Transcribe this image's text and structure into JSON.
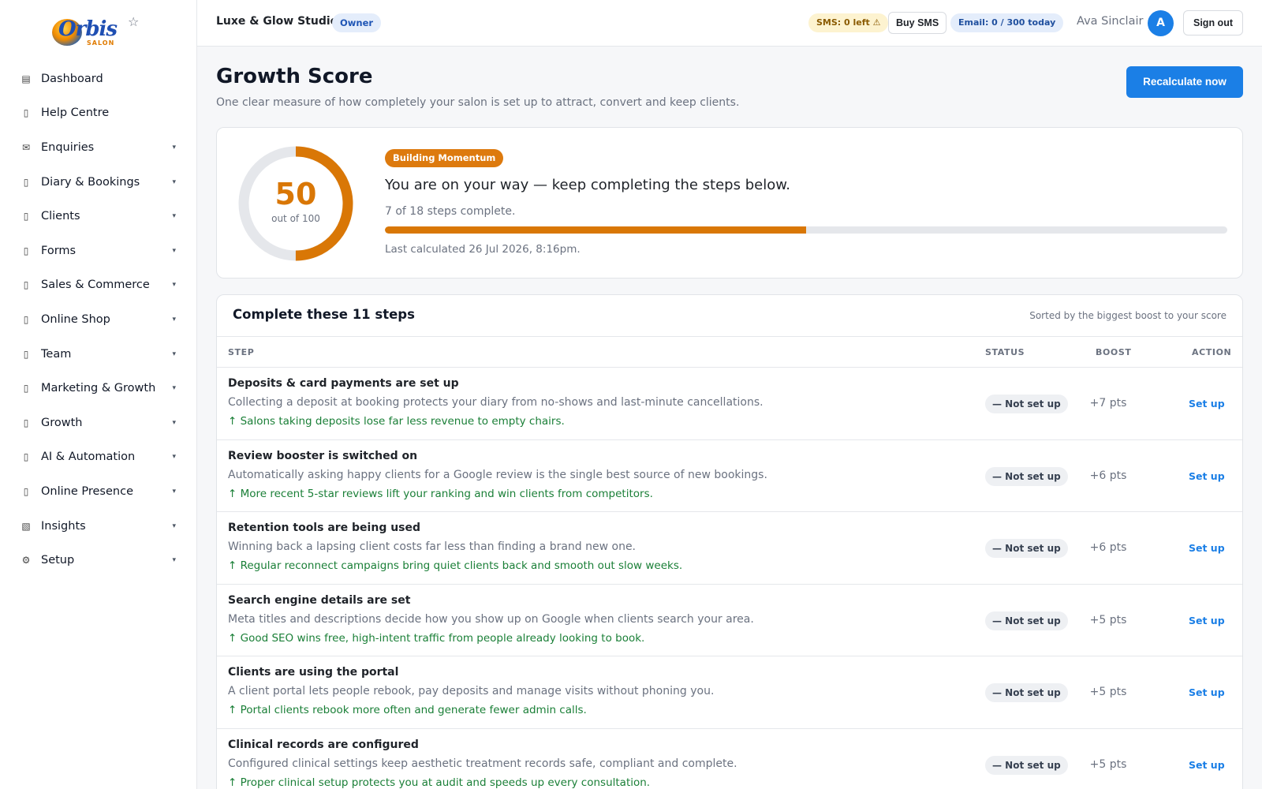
{
  "brand": {
    "logo_word": "Orbis",
    "logo_sub": "SALON"
  },
  "sidebar": {
    "items": [
      {
        "label": "Dashboard",
        "icon": "▤",
        "caret": ""
      },
      {
        "label": "Help Centre",
        "icon": "▯",
        "caret": ""
      },
      {
        "label": "Enquiries",
        "icon": "✉",
        "caret": "▾"
      },
      {
        "label": "Diary & Bookings",
        "icon": "▯",
        "caret": "▾"
      },
      {
        "label": "Clients",
        "icon": "▯",
        "caret": "▾"
      },
      {
        "label": "Forms",
        "icon": "▯",
        "caret": "▾"
      },
      {
        "label": "Sales & Commerce",
        "icon": "▯",
        "caret": "▾"
      },
      {
        "label": "Online Shop",
        "icon": "▯",
        "caret": "▾"
      },
      {
        "label": "Team",
        "icon": "▯",
        "caret": "▾"
      },
      {
        "label": "Marketing & Growth",
        "icon": "▯",
        "caret": "▾"
      },
      {
        "label": "Growth",
        "icon": "▯",
        "caret": "▾"
      },
      {
        "label": "AI & Automation",
        "icon": "▯",
        "caret": "▾"
      },
      {
        "label": "Online Presence",
        "icon": "▯",
        "caret": "▾"
      },
      {
        "label": "Insights",
        "icon": "▧",
        "caret": "▾"
      },
      {
        "label": "Setup",
        "icon": "⚙",
        "caret": "▾"
      }
    ]
  },
  "topbar": {
    "studio_name": "Luxe & Glow Studio",
    "role_badge": "Owner",
    "sms_status": "SMS: 0 left ⚠",
    "buy_sms": "Buy SMS",
    "email_status": "Email: 0 / 300 today",
    "user_name": "Ava Sinclair",
    "avatar_initial": "A",
    "sign_out": "Sign out"
  },
  "header": {
    "title": "Growth Score",
    "subtitle": "One clear measure of how completely your salon is set up to attract, convert and keep clients.",
    "recalculate": "Recalculate now"
  },
  "score": {
    "value": "50",
    "out_of": "out of 100",
    "fraction": 0.5,
    "badge": "Building Momentum",
    "headline": "You are on your way — keep completing the steps below.",
    "steps_complete": "7 of 18 steps complete.",
    "progress_fraction": 0.5,
    "last_calculated": "Last calculated 26 Jul 2026, 8:16pm.",
    "accent_color": "#d97706"
  },
  "steps": {
    "title": "Complete these 11 steps",
    "sort_note": "Sorted by the biggest boost to your score",
    "columns": {
      "step": "STEP",
      "status": "STATUS",
      "boost": "BOOST",
      "action": "ACTION"
    },
    "rows": [
      {
        "title": "Deposits & card payments are set up",
        "desc": "Collecting a deposit at booking protects your diary from no-shows and last-minute cancellations.",
        "tip": "↑ Salons taking deposits lose far less revenue to empty chairs.",
        "status": "— Not set up",
        "boost": "+7 pts",
        "action": "Set up"
      },
      {
        "title": "Review booster is switched on",
        "desc": "Automatically asking happy clients for a Google review is the single best source of new bookings.",
        "tip": "↑ More recent 5-star reviews lift your ranking and win clients from competitors.",
        "status": "— Not set up",
        "boost": "+6 pts",
        "action": "Set up"
      },
      {
        "title": "Retention tools are being used",
        "desc": "Winning back a lapsing client costs far less than finding a brand new one.",
        "tip": "↑ Regular reconnect campaigns bring quiet clients back and smooth out slow weeks.",
        "status": "— Not set up",
        "boost": "+6 pts",
        "action": "Set up"
      },
      {
        "title": "Search engine details are set",
        "desc": "Meta titles and descriptions decide how you show up on Google when clients search your area.",
        "tip": "↑ Good SEO wins free, high-intent traffic from people already looking to book.",
        "status": "— Not set up",
        "boost": "+5 pts",
        "action": "Set up"
      },
      {
        "title": "Clients are using the portal",
        "desc": "A client portal lets people rebook, pay deposits and manage visits without phoning you.",
        "tip": "↑ Portal clients rebook more often and generate fewer admin calls.",
        "status": "— Not set up",
        "boost": "+5 pts",
        "action": "Set up"
      },
      {
        "title": "Clinical records are configured",
        "desc": "Configured clinical settings keep aesthetic treatment records safe, compliant and complete.",
        "tip": "↑ Proper clinical setup protects you at audit and speeds up every consultation.",
        "status": "— Not set up",
        "boost": "+5 pts",
        "action": "Set up"
      }
    ]
  }
}
